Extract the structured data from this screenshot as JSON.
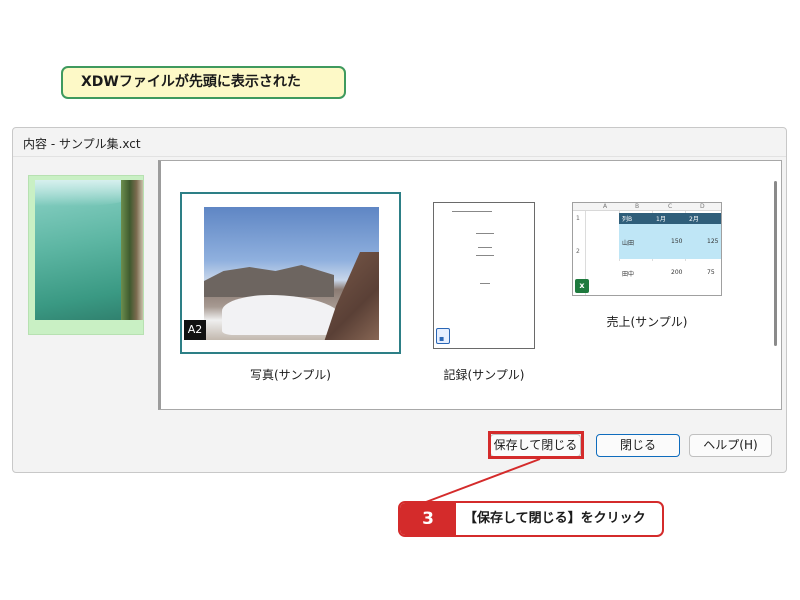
{
  "callout_top": {
    "text": "XDWファイルが先頭に表示された"
  },
  "dialog": {
    "title": "内容 - サンプル集.xct",
    "items": [
      {
        "label": "写真(サンプル)",
        "badge": "A2"
      },
      {
        "label": "記録(サンプル)"
      },
      {
        "label": "売上(サンプル)"
      }
    ],
    "sheet": {
      "columns": [
        "A",
        "B",
        "C",
        "D"
      ],
      "rows": [
        "1",
        "2"
      ],
      "header": [
        "列B",
        "1月",
        "2月"
      ],
      "row1": [
        "山田",
        "150",
        "125"
      ],
      "row2": [
        "田中",
        "200",
        "75"
      ]
    },
    "buttons": {
      "save": "保存して閉じる",
      "close": "閉じる",
      "help": "ヘルプ(H)"
    }
  },
  "callout_bottom": {
    "step": "3",
    "text": "【保存して閉じる】をクリック"
  },
  "colors": {
    "accent_red": "#d42b2b",
    "accent_green": "#3f9a5e",
    "selection_teal": "#2d7f86"
  }
}
